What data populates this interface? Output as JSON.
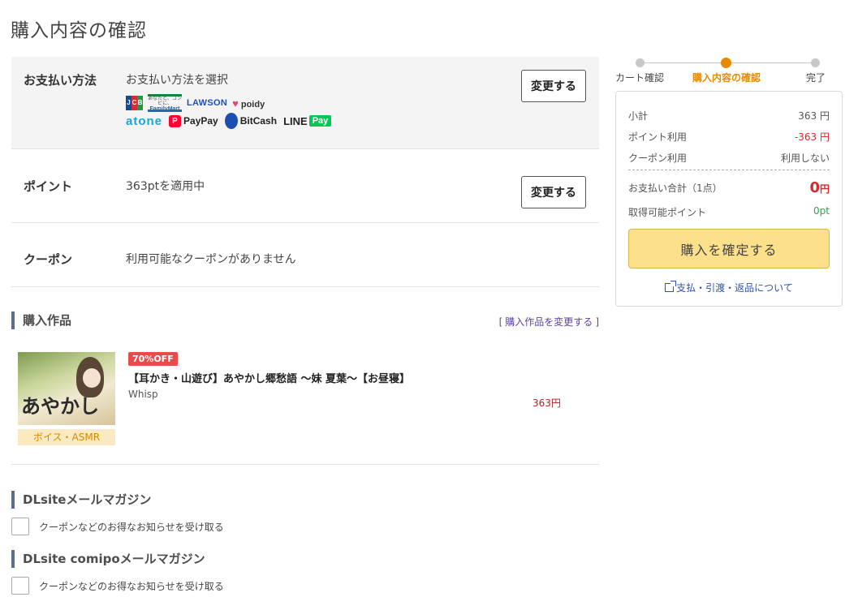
{
  "page": {
    "title": "購入内容の確認"
  },
  "payment": {
    "label": "お支払い方法",
    "value": "お支払い方法を選択",
    "change_label": "変更する",
    "logos": {
      "jcb": "JCB",
      "familymart_top": "あなたと、コンビに、",
      "familymart": "FamilyMart",
      "lawson": "LAWSON",
      "poidy": "poidy",
      "atone": "atone",
      "paypay": "PayPay",
      "bitcash": "BitCash",
      "line": "LINE",
      "line_pay": "Pay"
    }
  },
  "point": {
    "label": "ポイント",
    "value": "363ptを適用中",
    "change_label": "変更する"
  },
  "coupon": {
    "label": "クーポン",
    "value": "利用可能なクーポンがありません"
  },
  "purchase_items": {
    "header": "購入作品",
    "change_link_open": "[",
    "change_link": "購入作品を変更する",
    "change_link_close": "]",
    "item": {
      "discount": "70%OFF",
      "title": "【耳かき・山遊び】あやかし郷愁語 ～妹 夏葉～【お昼寝】",
      "maker": "Whisp",
      "price": "363円",
      "category": "ボイス・ASMR",
      "thumb_text": "あやかし"
    }
  },
  "newsletter": {
    "dlsite_header": "DLsiteメールマガジン",
    "dlsite_checkbox": "クーポンなどのお得なお知らせを受け取る",
    "comipo_header": "DLsite comipoメールマガジン",
    "comipo_checkbox": "クーポンなどのお得なお知らせを受け取る"
  },
  "stepper": {
    "steps": [
      "カート確認",
      "購入内容の確認",
      "完了"
    ],
    "active_index": 1,
    "active_color": "#e68a00"
  },
  "summary": {
    "subtotal_label": "小計",
    "subtotal_value": "363 円",
    "point_use_label": "ポイント利用",
    "point_use_value": "-363 円",
    "coupon_use_label": "クーポン利用",
    "coupon_use_value": "利用しない",
    "total_label": "お支払い合計（1点）",
    "total_value": "0",
    "total_unit": "円",
    "earn_label": "取得可能ポイント",
    "earn_value": "0pt",
    "confirm_label": "購入を確定する",
    "policy_link": "支払・引渡・返品について"
  }
}
